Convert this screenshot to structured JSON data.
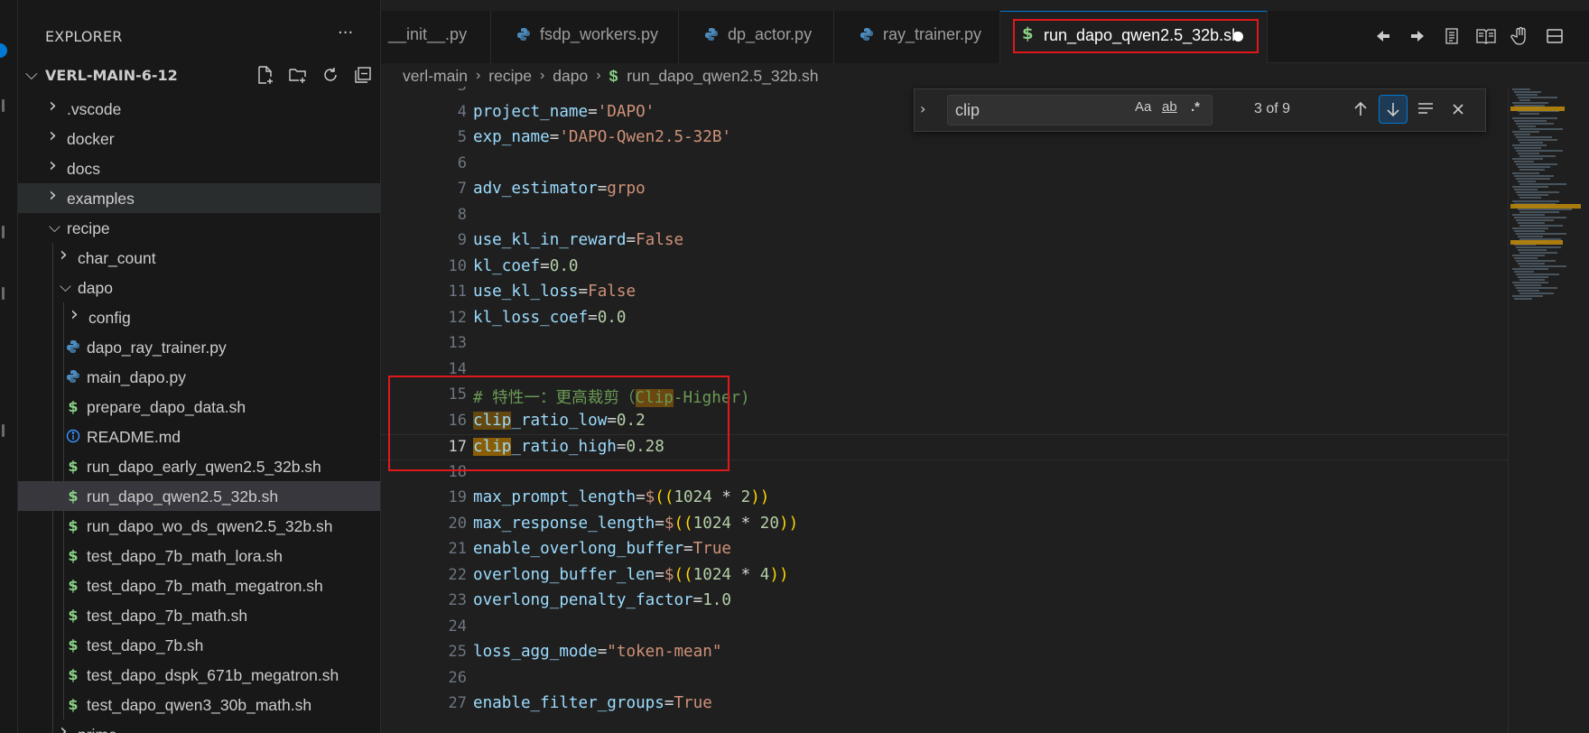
{
  "colors": {
    "accent": "#0078d4",
    "highlight_box": "#e0181b",
    "find_match": "#9e6a03",
    "shell_icon": "#89d185",
    "python_icon": "#4b8bbe",
    "info_icon": "#3794ff"
  },
  "sidebar": {
    "title": "EXPLORER",
    "more_icon": "ellipsis-icon",
    "root_label": "VERL-MAIN-6-12",
    "root_actions": [
      "new-file-icon",
      "new-folder-icon",
      "refresh-icon",
      "collapse-all-icon"
    ],
    "items": [
      {
        "label": ".vscode",
        "kind": "folder",
        "open": false,
        "depth": 1
      },
      {
        "label": "docker",
        "kind": "folder",
        "open": false,
        "depth": 1
      },
      {
        "label": "docs",
        "kind": "folder",
        "open": false,
        "depth": 1
      },
      {
        "label": "examples",
        "kind": "folder",
        "open": false,
        "depth": 1,
        "state": "hover"
      },
      {
        "label": "recipe",
        "kind": "folder",
        "open": true,
        "depth": 1
      },
      {
        "label": "char_count",
        "kind": "folder",
        "open": false,
        "depth": 2
      },
      {
        "label": "dapo",
        "kind": "folder",
        "open": true,
        "depth": 2
      },
      {
        "label": "config",
        "kind": "folder",
        "open": false,
        "depth": 3
      },
      {
        "label": "dapo_ray_trainer.py",
        "kind": "python",
        "depth": 3
      },
      {
        "label": "main_dapo.py",
        "kind": "python",
        "depth": 3
      },
      {
        "label": "prepare_dapo_data.sh",
        "kind": "shell",
        "depth": 3
      },
      {
        "label": "README.md",
        "kind": "info",
        "depth": 3
      },
      {
        "label": "run_dapo_early_qwen2.5_32b.sh",
        "kind": "shell",
        "depth": 3
      },
      {
        "label": "run_dapo_qwen2.5_32b.sh",
        "kind": "shell",
        "depth": 3,
        "state": "active"
      },
      {
        "label": "run_dapo_wo_ds_qwen2.5_32b.sh",
        "kind": "shell",
        "depth": 3
      },
      {
        "label": "test_dapo_7b_math_lora.sh",
        "kind": "shell",
        "depth": 3
      },
      {
        "label": "test_dapo_7b_math_megatron.sh",
        "kind": "shell",
        "depth": 3
      },
      {
        "label": "test_dapo_7b_math.sh",
        "kind": "shell",
        "depth": 3
      },
      {
        "label": "test_dapo_7b.sh",
        "kind": "shell",
        "depth": 3
      },
      {
        "label": "test_dapo_dspk_671b_megatron.sh",
        "kind": "shell",
        "depth": 3
      },
      {
        "label": "test_dapo_qwen3_30b_math.sh",
        "kind": "shell",
        "depth": 3
      },
      {
        "label": "prime",
        "kind": "folder",
        "open": false,
        "depth": 2
      }
    ]
  },
  "tabs": [
    {
      "label": "__init__.py",
      "icon": "none"
    },
    {
      "label": "fsdp_workers.py",
      "icon": "python-icon"
    },
    {
      "label": "dp_actor.py",
      "icon": "python-icon"
    },
    {
      "label": "ray_trainer.py",
      "icon": "python-icon"
    },
    {
      "label": "run_dapo_qwen2.5_32b.sh",
      "icon": "shell-icon",
      "active": true,
      "dirty": true
    }
  ],
  "tab_actions": [
    "arrow-left-icon",
    "arrow-right-icon",
    "open-changes-icon",
    "book-icon",
    "hand-icon",
    "split-editor-icon"
  ],
  "breadcrumb": [
    "verl-main",
    "recipe",
    "dapo",
    "run_dapo_qwen2.5_32b.sh"
  ],
  "find": {
    "query": "clip",
    "match_case_label": "Aa",
    "whole_word_label": "ab",
    "regex_label": ".*",
    "count": "3 of 9"
  },
  "editor": {
    "current_line": 17,
    "lines": [
      {
        "n": "3",
        "tokens": []
      },
      {
        "n": "4",
        "tokens": [
          [
            "var",
            "project_name"
          ],
          [
            "op",
            "="
          ],
          [
            "str",
            "'DAPO'"
          ]
        ]
      },
      {
        "n": "5",
        "tokens": [
          [
            "var",
            "exp_name"
          ],
          [
            "op",
            "="
          ],
          [
            "str",
            "'DAPO-Qwen2.5-32B'"
          ]
        ]
      },
      {
        "n": "6",
        "tokens": []
      },
      {
        "n": "7",
        "tokens": [
          [
            "var",
            "adv_estimator"
          ],
          [
            "op",
            "="
          ],
          [
            "str",
            "grpo"
          ]
        ]
      },
      {
        "n": "8",
        "tokens": []
      },
      {
        "n": "9",
        "tokens": [
          [
            "var",
            "use_kl_in_reward"
          ],
          [
            "op",
            "="
          ],
          [
            "str",
            "False"
          ]
        ]
      },
      {
        "n": "10",
        "tokens": [
          [
            "var",
            "kl_coef"
          ],
          [
            "op",
            "="
          ],
          [
            "num",
            "0.0"
          ]
        ]
      },
      {
        "n": "11",
        "tokens": [
          [
            "var",
            "use_kl_loss"
          ],
          [
            "op",
            "="
          ],
          [
            "str",
            "False"
          ]
        ]
      },
      {
        "n": "12",
        "tokens": [
          [
            "var",
            "kl_loss_coef"
          ],
          [
            "op",
            "="
          ],
          [
            "num",
            "0.0"
          ]
        ]
      },
      {
        "n": "13",
        "tokens": []
      },
      {
        "n": "14",
        "tokens": []
      },
      {
        "n": "15",
        "tokens": [
          [
            "cmt",
            "# 特性一：更高裁剪（"
          ],
          [
            "cmt-m",
            "Clip"
          ],
          [
            "cmt",
            "-Higher)"
          ]
        ]
      },
      {
        "n": "16",
        "tokens": [
          [
            "var-m",
            "clip"
          ],
          [
            "var",
            "_ratio_low"
          ],
          [
            "op",
            "="
          ],
          [
            "num",
            "0.2"
          ]
        ]
      },
      {
        "n": "17",
        "tokens": [
          [
            "var-mc",
            "clip"
          ],
          [
            "var",
            "_ratio_high"
          ],
          [
            "op",
            "="
          ],
          [
            "num",
            "0.28"
          ]
        ]
      },
      {
        "n": "18",
        "tokens": []
      },
      {
        "n": "19",
        "tokens": [
          [
            "var",
            "max_prompt_length"
          ],
          [
            "op",
            "="
          ],
          [
            "str",
            "$"
          ],
          [
            "yel",
            "(("
          ],
          [
            "num",
            "1024"
          ],
          [
            "op",
            " * "
          ],
          [
            "num",
            "2"
          ],
          [
            "yel",
            "))"
          ]
        ]
      },
      {
        "n": "20",
        "tokens": [
          [
            "var",
            "max_response_length"
          ],
          [
            "op",
            "="
          ],
          [
            "str",
            "$"
          ],
          [
            "yel",
            "(("
          ],
          [
            "num",
            "1024"
          ],
          [
            "op",
            " * "
          ],
          [
            "num",
            "20"
          ],
          [
            "yel",
            "))"
          ]
        ]
      },
      {
        "n": "21",
        "tokens": [
          [
            "var",
            "enable_overlong_buffer"
          ],
          [
            "op",
            "="
          ],
          [
            "str",
            "True"
          ]
        ]
      },
      {
        "n": "22",
        "tokens": [
          [
            "var",
            "overlong_buffer_len"
          ],
          [
            "op",
            "="
          ],
          [
            "str",
            "$"
          ],
          [
            "yel",
            "(("
          ],
          [
            "num",
            "1024"
          ],
          [
            "op",
            " * "
          ],
          [
            "num",
            "4"
          ],
          [
            "yel",
            "))"
          ]
        ]
      },
      {
        "n": "23",
        "tokens": [
          [
            "var",
            "overlong_penalty_factor"
          ],
          [
            "op",
            "="
          ],
          [
            "num",
            "1.0"
          ]
        ]
      },
      {
        "n": "24",
        "tokens": []
      },
      {
        "n": "25",
        "tokens": [
          [
            "var",
            "loss_agg_mode"
          ],
          [
            "op",
            "="
          ],
          [
            "str",
            "\"token-mean\""
          ]
        ]
      },
      {
        "n": "26",
        "tokens": []
      },
      {
        "n": "27",
        "tokens": [
          [
            "var",
            "enable_filter_groups"
          ],
          [
            "op",
            "="
          ],
          [
            "str",
            "True"
          ]
        ]
      }
    ]
  }
}
